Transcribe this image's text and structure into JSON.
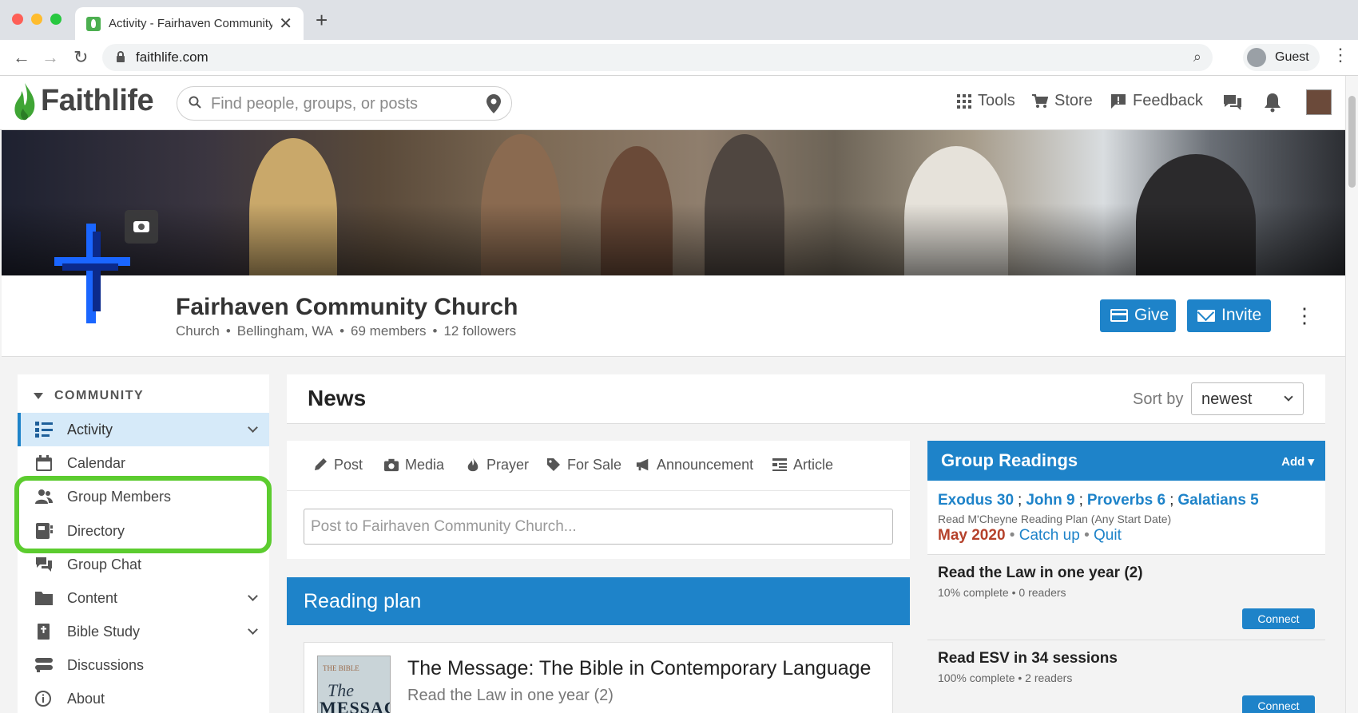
{
  "browser": {
    "tab_title": "Activity - Fairhaven Community Church",
    "tab_close": "✕",
    "new_tab": "+",
    "back": "←",
    "forward": "→",
    "reload": "↻",
    "url": "faithlife.com",
    "zoom_icon": "⌕",
    "profile_label": "Guest",
    "menu": "⋮"
  },
  "header": {
    "logo": "Faithlife",
    "search_placeholder": "Find people, groups, or posts",
    "nav": [
      {
        "label": "Tools",
        "icon": "grid-icon"
      },
      {
        "label": "Store",
        "icon": "cart-icon"
      },
      {
        "label": "Feedback",
        "icon": "feedback-icon"
      }
    ],
    "icons": [
      "chat-icon",
      "bell-icon",
      "avatar"
    ]
  },
  "group": {
    "name": "Fairhaven Community Church",
    "type": "Church",
    "location": "Bellingham, WA",
    "members": "69 members",
    "followers": "12 followers",
    "separator": "•",
    "give_label": "Give",
    "invite_label": "Invite",
    "more": "⋮"
  },
  "sidebar": {
    "section": "COMMUNITY",
    "items": [
      {
        "label": "Activity",
        "icon": "activity-icon",
        "active": true,
        "expandable": true
      },
      {
        "label": "Calendar",
        "icon": "calendar-icon"
      },
      {
        "label": "Group Members",
        "icon": "people-icon",
        "highlighted": true
      },
      {
        "label": "Directory",
        "icon": "directory-icon",
        "highlighted": true
      },
      {
        "label": "Group Chat",
        "icon": "chat-icon"
      },
      {
        "label": "Content",
        "icon": "folder-icon",
        "expandable": true
      },
      {
        "label": "Bible Study",
        "icon": "bible-icon",
        "expandable": true
      },
      {
        "label": "Discussions",
        "icon": "discussions-icon"
      },
      {
        "label": "About",
        "icon": "info-icon"
      }
    ],
    "highlight_color": "#5ccc2f"
  },
  "news": {
    "title": "News",
    "sort_label": "Sort by",
    "sort_value": "newest",
    "post_types": [
      {
        "label": "Post",
        "icon": "pencil-icon"
      },
      {
        "label": "Media",
        "icon": "camera-icon"
      },
      {
        "label": "Prayer",
        "icon": "flame-icon"
      },
      {
        "label": "For Sale",
        "icon": "tag-icon"
      },
      {
        "label": "Announcement",
        "icon": "megaphone-icon"
      },
      {
        "label": "Article",
        "icon": "article-icon"
      }
    ],
    "post_placeholder": "Post to Fairhaven Community Church...",
    "reading_plan_bar": "Reading plan",
    "reading_plan_card": {
      "book_cover_top": "THE BIBLE",
      "book_cover_mid": "The",
      "book_cover_bottom": "MESSAGE",
      "title": "The Message: The Bible in Contemporary Language",
      "subtitle": "Read the Law in one year (2)"
    }
  },
  "group_readings": {
    "title": "Group Readings",
    "add_label": "Add ▾",
    "current": {
      "refs": [
        "Exodus 30",
        "John 9",
        "Proverbs 6",
        "Galatians 5"
      ],
      "ref_sep": ";",
      "plan": "Read M'Cheyne Reading Plan (Any Start Date)",
      "month": "May 2020",
      "dot": "•",
      "catch_up": "Catch up",
      "quit": "Quit"
    },
    "plans": [
      {
        "name": "Read the Law in one year (2)",
        "meta": "10% complete • 0 readers",
        "action": "Connect"
      },
      {
        "name": "Read ESV in 34 sessions",
        "meta": "100% complete • 2 readers",
        "action": "Connect"
      }
    ]
  },
  "colors": {
    "accent": "#1e83c9",
    "brand_green": "#4caf50",
    "active_bg": "#d6eaf9",
    "month_red": "#b5412b"
  }
}
